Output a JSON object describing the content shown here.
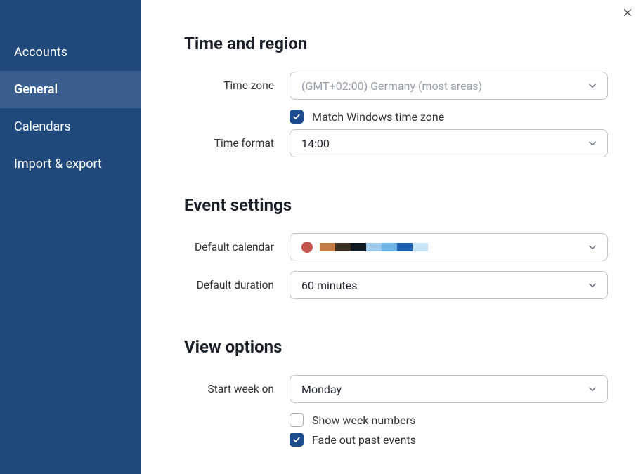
{
  "sidebar": {
    "items": [
      {
        "label": "Accounts"
      },
      {
        "label": "General"
      },
      {
        "label": "Calendars"
      },
      {
        "label": "Import & export"
      }
    ],
    "activeIndex": 1
  },
  "sections": {
    "timeRegion": {
      "title": "Time and region",
      "timezone": {
        "label": "Time zone",
        "value": "(GMT+02:00) Germany (most areas)",
        "matchLabel": "Match Windows time zone",
        "matchChecked": true
      },
      "timeFormat": {
        "label": "Time format",
        "value": "14:00"
      }
    },
    "eventSettings": {
      "title": "Event settings",
      "defaultCalendar": {
        "label": "Default calendar",
        "dotColor": "#c4554d",
        "stripColors": [
          "#c47b47",
          "#3a2f23",
          "#0f1a25",
          "#9dc9eb",
          "#6fb4e4",
          "#1f5fb2",
          "#c7e3f8"
        ]
      },
      "defaultDuration": {
        "label": "Default duration",
        "value": "60 minutes"
      }
    },
    "viewOptions": {
      "title": "View options",
      "startWeek": {
        "label": "Start week on",
        "value": "Monday"
      },
      "showWeekNumbers": {
        "label": "Show week numbers",
        "checked": false
      },
      "fadeOutPast": {
        "label": "Fade out past events",
        "checked": true
      }
    }
  }
}
